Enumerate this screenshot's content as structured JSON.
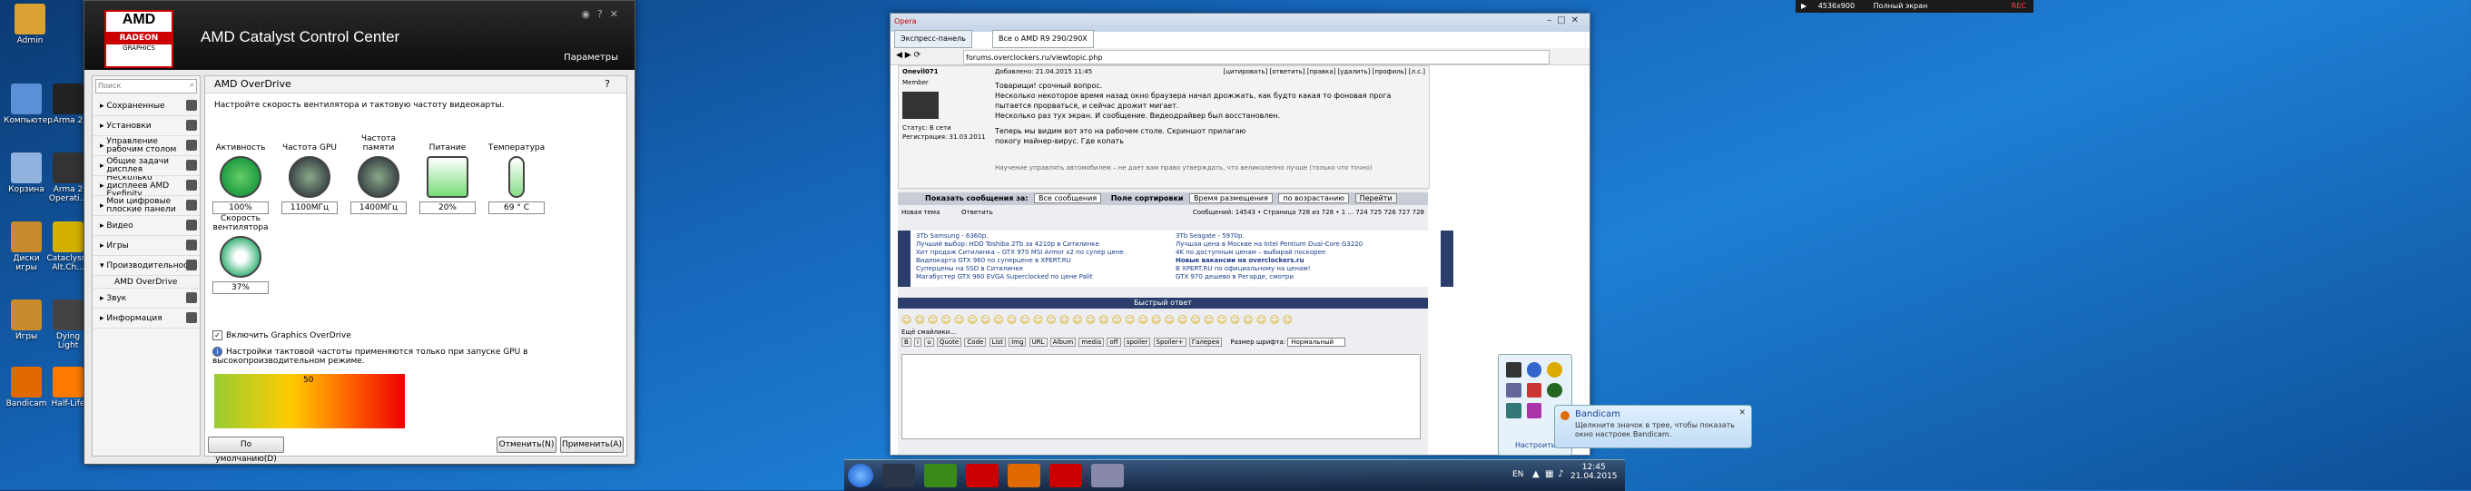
{
  "desktop": {
    "icons": [
      {
        "label": "Admin",
        "color": "#d9a233"
      },
      {
        "label": "Компьютер",
        "color": "#5b8fd6"
      },
      {
        "label": "Arma 2",
        "color": "#222222"
      },
      {
        "label": "Корзина",
        "color": "#8fb2de"
      },
      {
        "label": "Arma 2 Operati...",
        "color": "#333333"
      },
      {
        "label": "Диски игры",
        "color": "#c98b2c"
      },
      {
        "label": "Cataclysm Alt.Ch...",
        "color": "#d4b000"
      },
      {
        "label": "Игры",
        "color": "#c98b2c"
      },
      {
        "label": "Dying Light",
        "color": "#444444"
      },
      {
        "label": "Bandicam",
        "color": "#e06a00"
      },
      {
        "label": "Half-Life",
        "color": "#ff7b00"
      }
    ]
  },
  "amd": {
    "title": "AMD Catalyst Control Center",
    "logo": {
      "brand": "AMD",
      "product": "RADEON",
      "sub": "GRAPHICS"
    },
    "params": "Параметры",
    "search_placeholder": "Поиск",
    "nav": [
      "Сохраненные",
      "Установки",
      "Управление рабочим столом",
      "Общие задачи дисплея",
      "Несколько дисплеев AMD Eyefinity",
      "Мои цифровые плоские панели",
      "Видео",
      "Игры",
      "Производительность",
      "AMD OverDrive",
      "Звук",
      "Информация"
    ],
    "section_title": "AMD OverDrive",
    "description": "Настройте скорость вентилятора и тактовую частоту видеокарты.",
    "gauges": [
      {
        "label": "Активность",
        "value": "100%"
      },
      {
        "label": "Частота GPU",
        "value": "1100МГц"
      },
      {
        "label": "Частота памяти",
        "value": "1400МГц"
      },
      {
        "label": "Питание",
        "value": "20%"
      },
      {
        "label": "Температура",
        "value": "69 ° C"
      }
    ],
    "fan": {
      "label": "Скорость вентилятора",
      "value": "37%"
    },
    "enable_overdrive": "Включить Graphics OverDrive",
    "note": "Настройки тактовой частоты применяются только при запуске GPU в высокопроизводительном режиме.",
    "chart_value": "50",
    "buttons": {
      "default": "По умолчанию(D)",
      "cancel": "Отменить(N)",
      "apply": "Применить(A)"
    }
  },
  "browser": {
    "app": "Opera",
    "tabs": [
      "Экспресс-панель",
      "Все о AMD R9 290/290X"
    ],
    "url": "forums.overclockers.ru/viewtopic.php",
    "post": {
      "author": "Onevil071",
      "role": "Member",
      "status": "Статус: В сети",
      "registered": "Регистрация: 31.03.2011",
      "meta": "Добавлено: 21.04.2015 11:45",
      "actions": "[цитировать] [ответить] [правка] [удалить] [профиль] [л.с.]",
      "lines": [
        "Товарищи! срочный вопрос.",
        "Несколько некоторое время назад окно браузера начал дрожжать, как будто какая то фоновая прога",
        "пытается прорваться, и сейчас дрожит мигает.",
        "Несколько раз тух экран. И сообщение. Видеодрайвер был восстановлен.",
        "Теперь мы видим вот это на рабочем столе. Скриншот прилагаю",
        "покогу майнер-вирус. Где копать"
      ],
      "signature": "Научение управлять автомобилем – не дает вам право утверждать, что великолепно лучше (только что точно)"
    },
    "filter": {
      "label": "Показать сообщения за:",
      "value": "Все сообщения",
      "sort_label": "Поле сортировки",
      "sort_value": "Время размещения",
      "order_value": "по возрастанию",
      "go": "Перейти"
    },
    "pages": "Сообщений: 14543 • Страница 728 из 728 • 1 ... 724 725 726 727 728",
    "new_topic": "Новая тема",
    "reply": "Ответить",
    "ads_left": [
      "3Tb Samsung - 6360р.",
      "Лучший выбор: HDD Toshiba 2Tb за 4210р в Ситилинке",
      "Хит продаж Ситилинка – GTX 970 MSI Armor x2 по супер цене",
      "Видеокарта GTX 960 по суперцене в XPERT.RU",
      "Суперцены на SSD в Ситилинке",
      "Магабустер GTX 960 EVGA Superclocked по цене Palit"
    ],
    "ads_right": [
      "3Tb Seagate - 5970р.",
      "Лучшая цена в Москве на Intel Pentium Dual-Core G3220",
      "4K по доступным ценам – выбирай поскорее",
      "Новые вакансии на overclockers.ru",
      "В XPERT.RU по официальному на ценам!",
      "GTX 970 дешево в Регарде, смотри"
    ],
    "quick_reply": "Быстрый ответ",
    "quick_reply_more": "Ещё смайлики...",
    "toolbar_labels": [
      "B",
      "i",
      "u",
      "Quote",
      "Code",
      "List",
      "Img",
      "URL",
      "Album",
      "media",
      "off",
      "spoiler",
      "Spoiler+",
      "Галерея"
    ],
    "font_size_label": "Размер шрифта:",
    "font_size_value": "Нормальный"
  },
  "tray": {
    "bandicam_title": "Bandicam",
    "bandicam_text": "Щелкните значок в трее, чтобы показать окно настроек Bandicam.",
    "settings_link": "Настроить...",
    "lang": "EN",
    "time": "12:45",
    "date": "21.04.2015"
  },
  "topbar": {
    "res": "4536x900",
    "mode": "Полный экран",
    "rec": "REC"
  }
}
